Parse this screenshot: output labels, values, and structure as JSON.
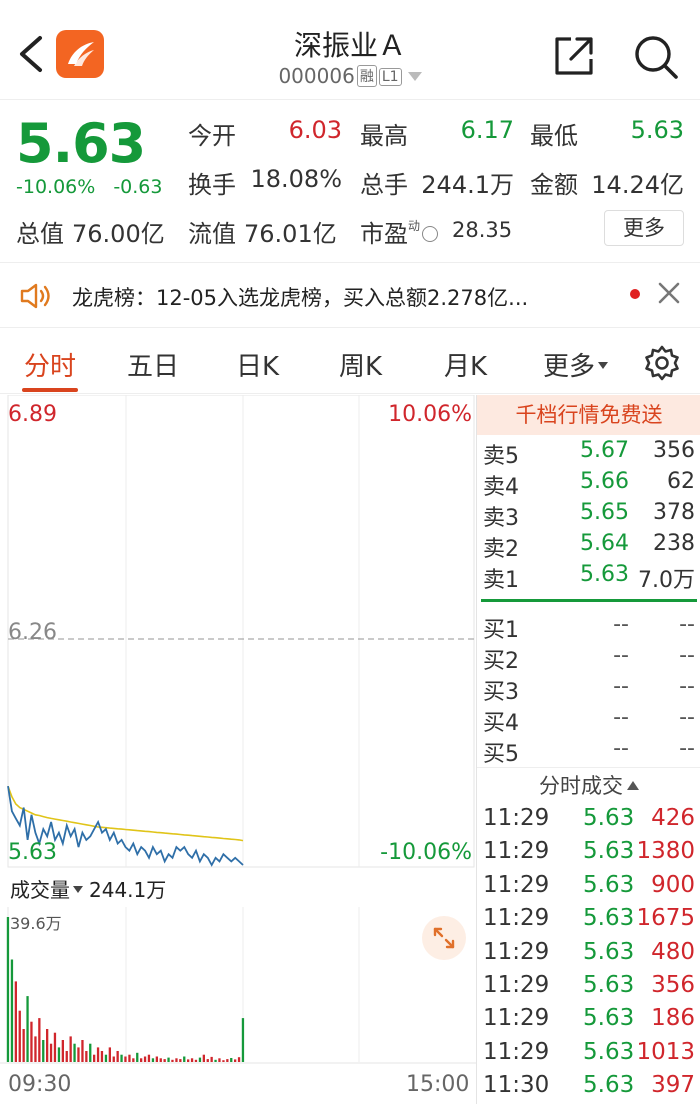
{
  "header": {
    "title": "深振业Ａ",
    "code": "000006",
    "tag_margin": "融",
    "tag_level": "L1"
  },
  "quote": {
    "price": "5.63",
    "change_pct": "-10.06%",
    "change": "-0.63",
    "stats": {
      "open_label": "今开",
      "open": "6.03",
      "high_label": "最高",
      "high": "6.17",
      "low_label": "最低",
      "low": "5.63",
      "turnover_label": "换手",
      "turnover": "18.08%",
      "volume_label": "总手",
      "volume": "244.1万",
      "amount_label": "金额",
      "amount": "14.24亿",
      "mktcap_label": "总值",
      "mktcap": "76.00亿",
      "float_label": "流值",
      "float_cap": "76.01亿",
      "pe_label": "市盈",
      "pe_dyn": "动",
      "pe": "28.35"
    },
    "more_label": "更多"
  },
  "dragon_tiger": {
    "text": "龙虎榜：12-05入选龙虎榜，买入总额2.278亿..."
  },
  "tabs": [
    {
      "label": "分时",
      "active": true
    },
    {
      "label": "五日"
    },
    {
      "label": "日K"
    },
    {
      "label": "周K"
    },
    {
      "label": "月K"
    },
    {
      "label": "更多"
    }
  ],
  "chart": {
    "top_price": "6.89",
    "top_pct": "10.06%",
    "mid_price": "6.26",
    "bottom_price": "5.63",
    "bottom_pct": "-10.06%",
    "volume_label": "成交量",
    "volume_total": "244.1万",
    "volume_max": "39.6万",
    "time_start": "09:30",
    "time_end": "15:00"
  },
  "chart_data": {
    "type": "line",
    "title": "",
    "ylim": [
      5.63,
      6.89
    ],
    "reference_price": 6.26,
    "series": [
      {
        "values": [
          5.85,
          5.78,
          5.76,
          5.74,
          5.79,
          5.7,
          5.77,
          5.72,
          5.69,
          5.73,
          5.71,
          5.75,
          5.7,
          5.72,
          5.69,
          5.74,
          5.71,
          5.73,
          5.68,
          5.72,
          5.7,
          5.71,
          5.73,
          5.75,
          5.72,
          5.73,
          5.7,
          5.72,
          5.69,
          5.7,
          5.68,
          5.67,
          5.69,
          5.66,
          5.68,
          5.67,
          5.65,
          5.68,
          5.66,
          5.67,
          5.64,
          5.66,
          5.65,
          5.68,
          5.67,
          5.68,
          5.66,
          5.65,
          5.67,
          5.64,
          5.66,
          5.65,
          5.63,
          5.65,
          5.64,
          5.66,
          5.65,
          5.64,
          5.65,
          5.64,
          5.63
        ]
      },
      {
        "values": [
          5.85,
          5.82,
          5.8,
          5.79,
          5.785,
          5.78,
          5.775,
          5.77,
          5.768,
          5.765,
          5.762,
          5.76,
          5.758,
          5.756,
          5.754,
          5.752,
          5.75,
          5.748,
          5.746,
          5.744,
          5.742,
          5.74,
          5.738,
          5.736,
          5.735,
          5.734,
          5.733,
          5.732,
          5.731,
          5.73,
          5.729,
          5.728,
          5.727,
          5.726,
          5.725,
          5.724,
          5.723,
          5.722,
          5.721,
          5.72,
          5.719,
          5.718,
          5.717,
          5.716,
          5.715,
          5.714,
          5.713,
          5.712,
          5.711,
          5.71,
          5.709,
          5.708,
          5.707,
          5.706,
          5.705,
          5.704,
          5.703,
          5.702,
          5.701,
          5.7,
          5.698
        ]
      }
    ],
    "volume": {
      "ylim": [
        0,
        39.6
      ],
      "values": [
        39.6,
        28,
        22,
        14,
        9,
        18,
        11,
        7,
        12,
        6,
        9,
        5,
        8,
        4,
        6,
        3,
        7,
        5,
        4,
        6,
        3,
        5,
        2,
        4,
        3,
        2,
        4,
        1.5,
        3,
        2,
        1.5,
        2,
        1,
        2.5,
        1,
        1.5,
        2,
        1,
        1.5,
        1,
        0.8,
        1.2,
        0.6,
        1,
        0.8,
        1.5,
        0.7,
        1,
        0.6,
        1.2,
        2,
        0.8,
        1.4,
        0.6,
        1,
        0.5,
        0.8,
        1.1,
        0.7,
        1.3,
        12
      ]
    }
  },
  "order_book": {
    "banner": "千档行情免费送",
    "asks": [
      {
        "label": "卖5",
        "price": "5.67",
        "qty": "356"
      },
      {
        "label": "卖4",
        "price": "5.66",
        "qty": "62"
      },
      {
        "label": "卖3",
        "price": "5.65",
        "qty": "378"
      },
      {
        "label": "卖2",
        "price": "5.64",
        "qty": "238"
      },
      {
        "label": "卖1",
        "price": "5.63",
        "qty": "7.0万"
      }
    ],
    "bids": [
      {
        "label": "买1",
        "price": "--",
        "qty": "--"
      },
      {
        "label": "买2",
        "price": "--",
        "qty": "--"
      },
      {
        "label": "买3",
        "price": "--",
        "qty": "--"
      },
      {
        "label": "买4",
        "price": "--",
        "qty": "--"
      },
      {
        "label": "买5",
        "price": "--",
        "qty": "--"
      }
    ]
  },
  "trades": {
    "header": "分时成交",
    "rows": [
      {
        "time": "11:29",
        "price": "5.63",
        "qty": "426"
      },
      {
        "time": "11:29",
        "price": "5.63",
        "qty": "1380"
      },
      {
        "time": "11:29",
        "price": "5.63",
        "qty": "900"
      },
      {
        "time": "11:29",
        "price": "5.63",
        "qty": "1675"
      },
      {
        "time": "11:29",
        "price": "5.63",
        "qty": "480"
      },
      {
        "time": "11:29",
        "price": "5.63",
        "qty": "356"
      },
      {
        "time": "11:29",
        "price": "5.63",
        "qty": "186"
      },
      {
        "time": "11:29",
        "price": "5.63",
        "qty": "1013"
      },
      {
        "time": "11:30",
        "price": "5.63",
        "qty": "397"
      }
    ]
  },
  "colors": {
    "up": "#d0262c",
    "down": "#15993a",
    "accent": "#d9441e",
    "price_line": "#2f6fa8",
    "avg_line": "#e0c419"
  },
  "icons": {
    "back": "chevron-left-icon",
    "logo": "app-logo-icon",
    "share": "share-icon",
    "search": "search-icon",
    "speaker": "speaker-icon",
    "close": "close-icon",
    "settings": "gear-icon",
    "expand": "expand-icon"
  }
}
